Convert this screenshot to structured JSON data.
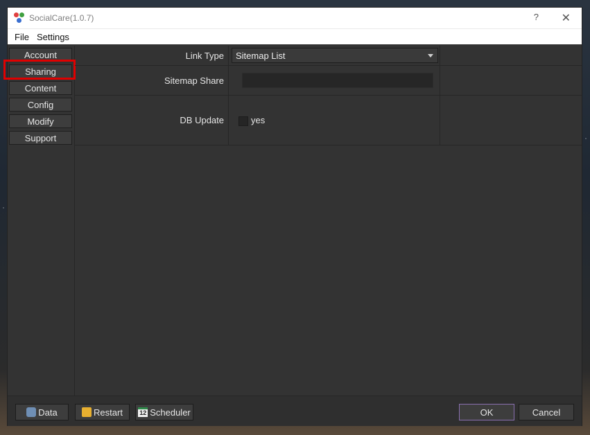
{
  "window": {
    "title": "SocialCare(1.0.7)",
    "help": "?",
    "close": "✕"
  },
  "menu": [
    "File",
    "Settings"
  ],
  "sidebar": {
    "items": [
      "Account",
      "Sharing",
      "Content",
      "Config",
      "Modify",
      "Support"
    ],
    "selected": "Sharing"
  },
  "form": {
    "link_type": {
      "label": "Link Type",
      "value": "Sitemap List"
    },
    "sitemap_share": {
      "label": "Sitemap Share",
      "value": ""
    },
    "db_update": {
      "label": "DB Update",
      "checkbox_label": "yes",
      "checked": false
    }
  },
  "bottom": {
    "data": "Data",
    "restart": "Restart",
    "scheduler": "Scheduler",
    "scheduler_icon_text": "12",
    "ok": "OK",
    "cancel": "Cancel"
  },
  "colors": {
    "accent_highlight": "#e00000",
    "ok_border": "#8a70b0"
  }
}
